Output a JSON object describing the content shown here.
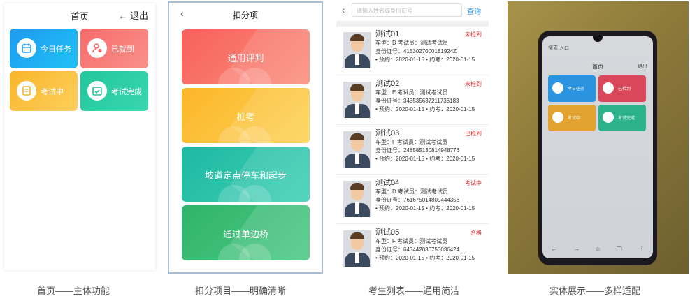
{
  "home": {
    "title": "首页",
    "exit_icon": "←",
    "exit_label": "退出",
    "tiles": [
      {
        "label": "今日任务",
        "icon": "calendar-icon",
        "color": "#1e9bf0"
      },
      {
        "label": "已就到",
        "icon": "user-check-icon",
        "color": "#f76b6b"
      },
      {
        "label": "考试中",
        "icon": "document-icon",
        "color": "#f9b52b"
      },
      {
        "label": "考试完成",
        "icon": "calendar-check-icon",
        "color": "#22c79b"
      }
    ]
  },
  "deduct": {
    "back_icon": "‹",
    "title": "扣分项",
    "items": [
      {
        "label": "通用评判",
        "color": "#f7605c"
      },
      {
        "label": "桩考",
        "color": "#fcb52a"
      },
      {
        "label": "坡道定点停车和起步",
        "color": "#1fb8a2"
      },
      {
        "label": "通过单边桥",
        "color": "#2fb36a"
      }
    ]
  },
  "list": {
    "back_icon": "‹",
    "search_placeholder": "请输入姓名或身份证号",
    "query_label": "查询",
    "rows": [
      {
        "name": "测试01",
        "status": "未检到",
        "l1": "车型：D  考试员：测试考试员",
        "l2": "身份证号：4153027000181924Z",
        "l3": "• 预约：2020-01-15  • 约考：2020-01-15"
      },
      {
        "name": "测试02",
        "status": "未检到",
        "l1": "车型：E  考试员：测试考试员",
        "l2": "身份证号：343535637211736183",
        "l3": "• 预约：2020-01-15  • 约考：2020-01-15"
      },
      {
        "name": "测试03",
        "status": "已检到",
        "l1": "车型：F  考试员：测试考试员",
        "l2": "身份证号：248585130814948776",
        "l3": "• 预约：2020-01-15  • 约考：2020-01-15"
      },
      {
        "name": "测试04",
        "status": "考试中",
        "l1": "车型：D  考试员：测试考试员",
        "l2": "身份证号：761675014809444358",
        "l3": "• 预约：2020-01-15  • 约考：2020-01-15"
      },
      {
        "name": "测试05",
        "status": "合格",
        "l1": "车型：F  考试员：测试考试员",
        "l2": "身份证号：643442036753036424",
        "l3": "• 预约：2020-01-15  • 约考：2020-01-15"
      }
    ]
  },
  "device": {
    "url": "搜索 入口",
    "title": "首页",
    "exit_label": "退出",
    "tiles": [
      {
        "label": "今日任务"
      },
      {
        "label": "已检到"
      },
      {
        "label": "考试中"
      },
      {
        "label": "考试完成"
      }
    ],
    "nav": [
      "←",
      "→",
      "⌂",
      "▢",
      "⋮"
    ]
  },
  "captions": [
    "首页——主体功能",
    "扣分项目——明确清晰",
    "考生列表——通用简洁",
    "实体展示——多样适配"
  ]
}
